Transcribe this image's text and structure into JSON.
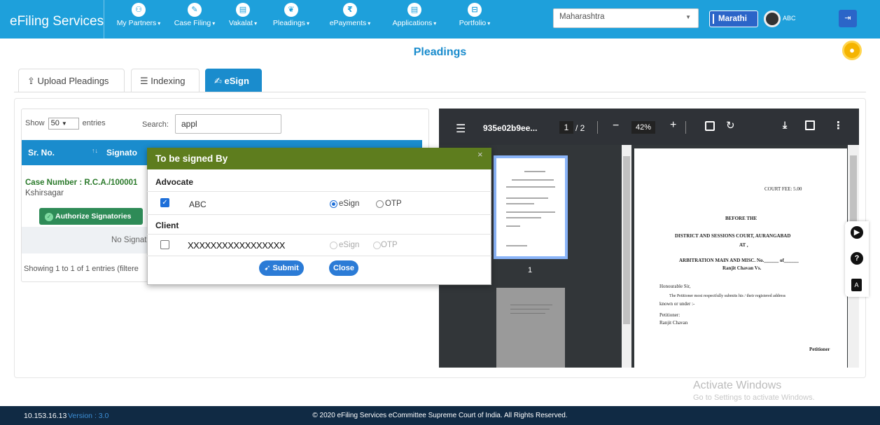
{
  "nav": {
    "brand": "eFiling Services",
    "items": [
      {
        "label": "My Partners",
        "icon": "partners-icon",
        "glyph": "⚇"
      },
      {
        "label": "Case Filing",
        "icon": "pencil-icon",
        "glyph": "✎"
      },
      {
        "label": "Vakalat",
        "icon": "document-icon",
        "glyph": "▤"
      },
      {
        "label": "Pleadings",
        "icon": "users-icon",
        "glyph": "❦"
      },
      {
        "label": "ePayments",
        "icon": "rupee-icon",
        "glyph": "₹"
      },
      {
        "label": "Applications",
        "icon": "file-icon",
        "glyph": "▤"
      },
      {
        "label": "Portfolio",
        "icon": "briefcase-icon",
        "glyph": "⊟"
      }
    ],
    "state": "Maharashtra",
    "language": "Marathi",
    "user": "ABC"
  },
  "page": {
    "title": "Pleadings",
    "tabs": [
      {
        "label": "Upload Pleadings",
        "icon": "upload-icon",
        "glyph": "⇪"
      },
      {
        "label": "Indexing",
        "icon": "list-icon",
        "glyph": "☰"
      },
      {
        "label": "eSign",
        "icon": "user-sign-icon",
        "glyph": "✍"
      }
    ]
  },
  "table": {
    "show_label": "Show",
    "entries_value": "50",
    "entries_label": "entries",
    "search_label": "Search:",
    "search_value": "appl",
    "col_srno": "Sr. No.",
    "col_signatory": "Signato",
    "case_number": "Case Number : R.C.A./100001",
    "case_party": "Kshirsagar",
    "authorize_label": "Authorize Signatories",
    "no_signatory": "No Signat",
    "info": "Showing 1 to 1 of 1 entries (filtere"
  },
  "pdf": {
    "title": "935e02b9ee...",
    "page": "1",
    "total": "/ 2",
    "zoom": "42%",
    "thumb_label": "1",
    "doc_lines": [
      "COURT FEE: 5.00",
      "BEFORE THE",
      "DISTRICT AND SESSIONS COURT, AURANGABAD",
      "AT ,",
      "ARBITRATION MAIN AND MISC. No.______ of______",
      "Ranjit Chavan Vs.",
      "Honourable Sir,",
      "The Petitioner most respectfully submits his / their registered address",
      "known or under :-",
      "Petitioner:",
      "Ranjit Chavan",
      "Petitioner"
    ]
  },
  "modal": {
    "title": "To be signed By",
    "close_x": "×",
    "advocate_heading": "Advocate",
    "advocate_name": "ABC",
    "advocate_checked": true,
    "advocate_method": "eSign",
    "client_heading": "Client",
    "client_name": "XXXXXXXXXXXXXXXXX",
    "client_checked": false,
    "option_esign": "eSign",
    "option_otp": "OTP",
    "submit_label": "Submit",
    "close_label": "Close"
  },
  "watermark": {
    "line1": "Activate Windows",
    "line2": "Go to Settings to activate Windows."
  },
  "footer": {
    "ip": "10.153.16.13",
    "version": "Version : 3.0",
    "copyright": "© 2020 eFiling Services eCommittee Supreme Court of India. All Rights Reserved."
  },
  "colors": {
    "nav_bg": "#1ea0db",
    "accent": "#1a8ccd",
    "modal_header": "#5e7d1e",
    "authorize_green": "#2e8b57",
    "footer_bg": "#102a44"
  }
}
